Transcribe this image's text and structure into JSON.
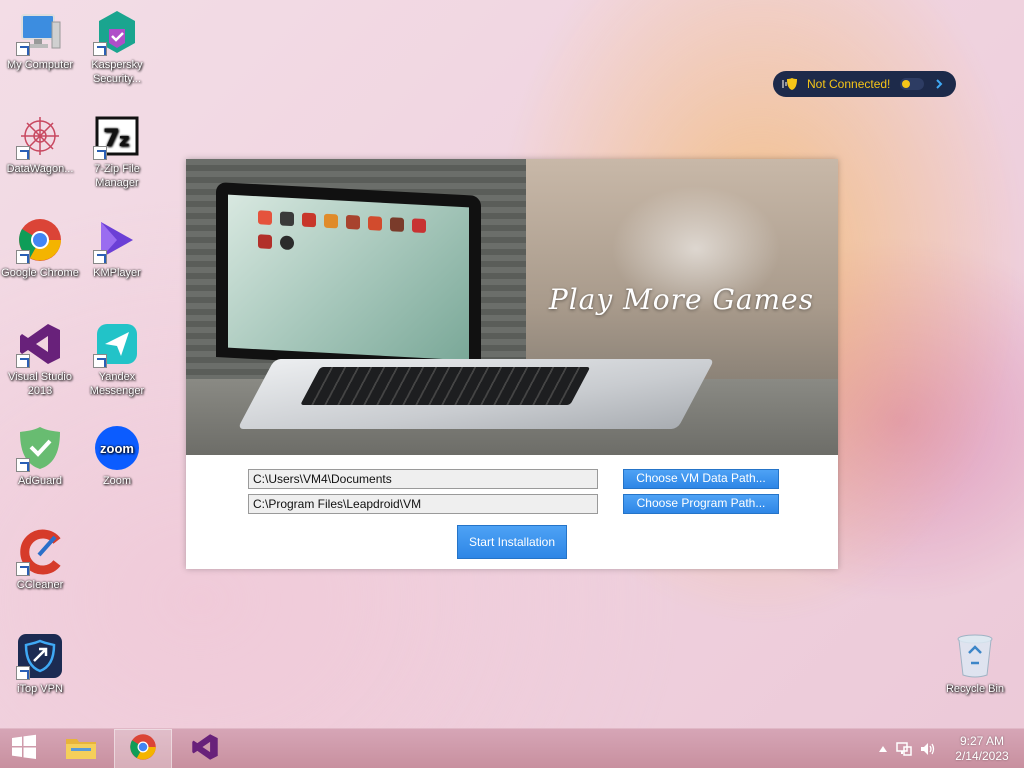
{
  "desktop": {
    "icons": [
      {
        "label": "My Computer"
      },
      {
        "label": "Kaspersky Security..."
      },
      {
        "label": "DataWagon..."
      },
      {
        "label": "7-Zip File Manager"
      },
      {
        "label": "Google Chrome"
      },
      {
        "label": "KMPlayer"
      },
      {
        "label": "Visual Studio 2013"
      },
      {
        "label": "Yandex Messenger"
      },
      {
        "label": "AdGuard"
      },
      {
        "label": "Zoom"
      },
      {
        "label": "CCleaner"
      },
      {
        "label": "iTop VPN"
      },
      {
        "label": "Recycle Bin"
      }
    ]
  },
  "vpn_widget": {
    "status": "Not Connected!",
    "status_color": "#f5c518"
  },
  "installer": {
    "tagline": "Play More Games",
    "vm_data_path": "C:\\Users\\VM4\\Documents",
    "program_path": "C:\\Program Files\\Leapdroid\\VM",
    "choose_vm_label": "Choose VM Data Path...",
    "choose_program_label": "Choose Program Path...",
    "start_label": "Start Installation",
    "accent_color": "#2e86e6"
  },
  "taskbar": {
    "apps": [
      "start-icon",
      "file-explorer-icon",
      "chrome-icon",
      "visual-studio-icon"
    ],
    "clock_time": "9:27 AM",
    "clock_date": "2/14/2023"
  }
}
